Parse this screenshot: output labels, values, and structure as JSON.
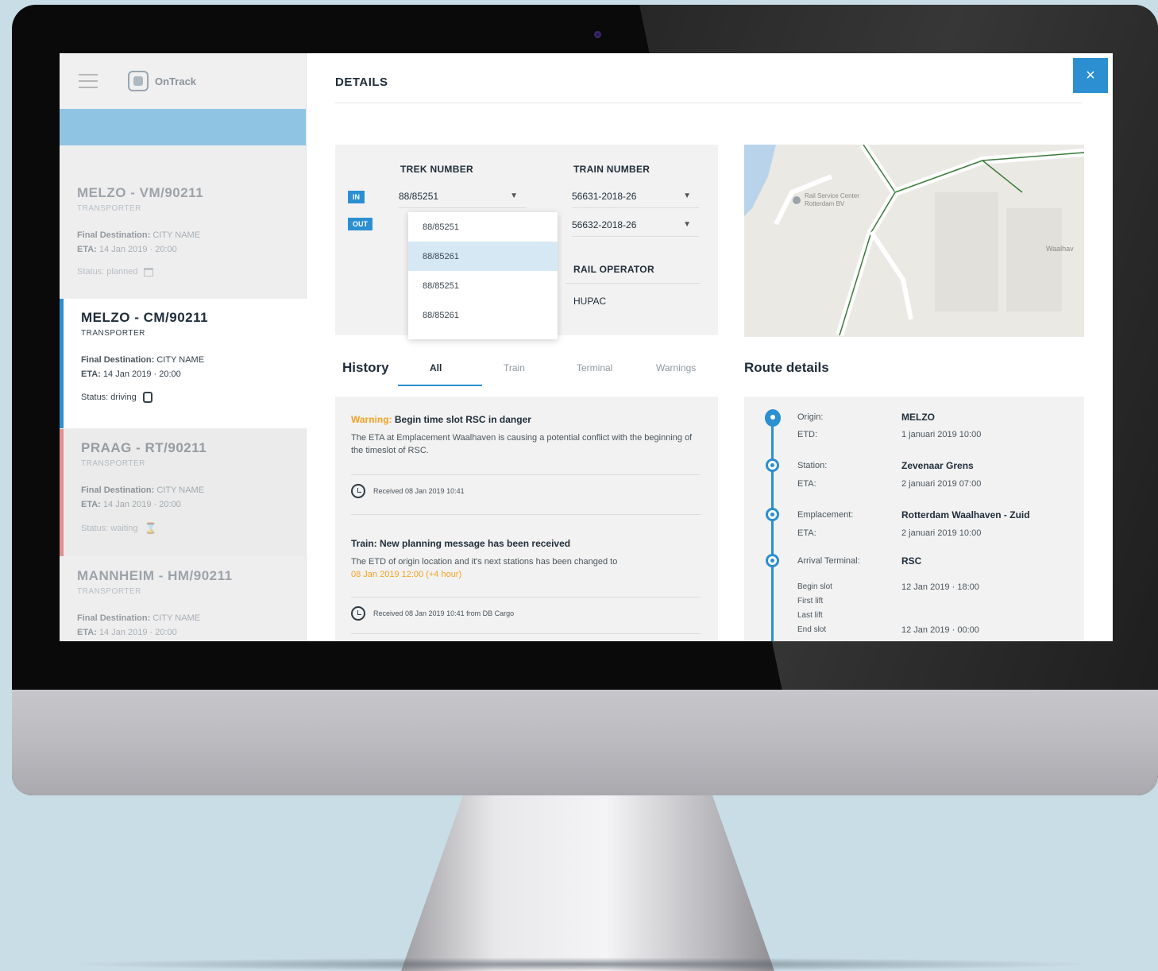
{
  "sidebar": {
    "logo": "OnTrack",
    "cards": [
      {
        "title": "MELZO - VM/90211",
        "sub": "TRANSPORTER",
        "dest_label": "Final Destination:",
        "dest_value": "CITY NAME",
        "eta_label": "ETA:",
        "eta_value": "14 Jan 2019 · 20:00",
        "status": "Status: planned"
      },
      {
        "title": "MELZO - CM/90211",
        "sub": "TRANSPORTER",
        "dest_label": "Final Destination:",
        "dest_value": "CITY NAME",
        "eta_label": "ETA:",
        "eta_value": "14 Jan 2019 · 20:00",
        "status": "Status: driving"
      },
      {
        "title": "PRAAG - RT/90211",
        "sub": "TRANSPORTER",
        "dest_label": "Final Destination:",
        "dest_value": "CITY NAME",
        "eta_label": "ETA:",
        "eta_value": "14 Jan 2019 · 20:00",
        "status": "Status: waiting"
      },
      {
        "title": "MANNHEIM - HM/90211",
        "sub": "TRANSPORTER",
        "dest_label": "Final Destination:",
        "dest_value": "CITY NAME",
        "eta_label": "ETA:",
        "eta_value": "14 Jan 2019 · 20:00"
      }
    ]
  },
  "details": {
    "title": "DETAILS",
    "close": "×",
    "trek_label": "TREK NUMBER",
    "train_label": "TRAIN NUMBER",
    "tag_in": "IN",
    "tag_out": "OUT",
    "trek_value": "88/85251",
    "train_in": "56631-2018-26",
    "train_out": "56632-2018-26",
    "rail_label": "RAIL OPERATOR",
    "rail_value": "HUPAC",
    "dropdown_options": [
      "88/85251",
      "88/85261",
      "88/85251",
      "88/85261"
    ],
    "map": {
      "place_label": "Rail Service Center Rotterdam BV",
      "edge_label": "Waalhav"
    },
    "history": {
      "title": "History",
      "tabs": [
        "All",
        "Train",
        "Terminal",
        "Warnings"
      ],
      "messages": [
        {
          "prefix": "Warning:",
          "head": "Begin time slot RSC in danger",
          "body": "The ETA at Emplacement Waalhaven is causing a potential conflict with the beginning of the timeslot of RSC.",
          "meta": "Received 08 Jan 2019 10:41"
        },
        {
          "head": "Train: New planning message has been received",
          "body": "The ETD of origin location and it's next stations has been changed to",
          "body_highlight": "08 Jan 2019 12:00 (+4 hour)",
          "meta": "Received 08 Jan 2019 10:41 from DB Cargo"
        }
      ]
    },
    "route": {
      "title": "Route details",
      "stops": [
        {
          "label1": "Origin:",
          "value1": "MELZO",
          "label2": "ETD:",
          "value2": "1 januari 2019 10:00"
        },
        {
          "label1": "Station:",
          "value1": "Zevenaar Grens",
          "label2": "ETA:",
          "value2": "2 januari 2019 07:00"
        },
        {
          "label1": "Emplacement:",
          "value1": "Rotterdam Waalhaven - Zuid",
          "label2": "ETA:",
          "value2": "2 januari 2019 10:00"
        },
        {
          "label1": "Arrival Terminal:",
          "value1": "RSC"
        }
      ],
      "slots": {
        "begin_label": "Begin slot",
        "begin_value": "12 Jan 2019 · 18:00",
        "first_label": "First lift",
        "last_label": "Last lift",
        "end_label": "End slot",
        "end_value": "12 Jan 2019 · 00:00"
      }
    }
  },
  "colors": {
    "accent": "#2b8fd1",
    "warning": "#f0a323",
    "alert": "#d9534f"
  }
}
